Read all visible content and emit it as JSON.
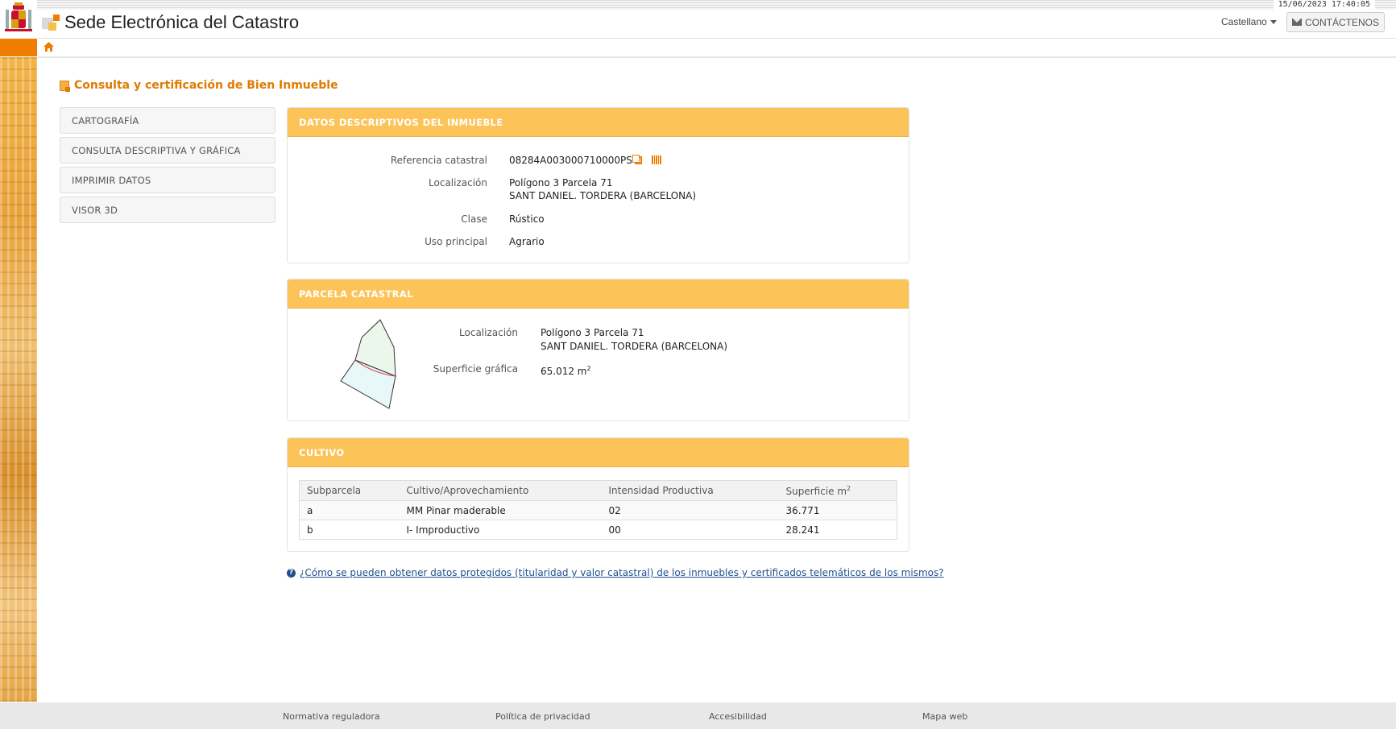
{
  "header": {
    "datetime": "15/06/2023  17:40:05",
    "site_title": "Sede Electrónica del Catastro",
    "language": "Castellano",
    "contact_label": "CONTÁCTENOS"
  },
  "page": {
    "title": "Consulta y certificación de Bien Inmueble"
  },
  "menu": {
    "items": [
      {
        "label": "CARTOGRAFÍA"
      },
      {
        "label": "CONSULTA DESCRIPTIVA Y GRÁFICA"
      },
      {
        "label": "IMPRIMIR DATOS"
      },
      {
        "label": "VISOR 3D"
      }
    ]
  },
  "descriptive": {
    "heading": "DATOS DESCRIPTIVOS DEL INMUEBLE",
    "ref_label": "Referencia catastral",
    "ref_value": "08284A003000710000PS",
    "loc_label": "Localización",
    "loc_line1": "Polígono 3 Parcela 71",
    "loc_line2": "SANT DANIEL. TORDERA (BARCELONA)",
    "class_label": "Clase",
    "class_value": "Rústico",
    "use_label": "Uso principal",
    "use_value": "Agrario"
  },
  "parcel": {
    "heading": "PARCELA CATASTRAL",
    "loc_label": "Localización",
    "loc_line1": "Polígono 3 Parcela 71",
    "loc_line2": "SANT DANIEL. TORDERA (BARCELONA)",
    "area_label": "Superficie gráfica",
    "area_value": "65.012 m",
    "area_unit_sup": "2"
  },
  "crops": {
    "heading": "CULTIVO",
    "columns": {
      "subparcel": "Subparcela",
      "crop": "Cultivo/Aprovechamiento",
      "intensity": "Intensidad Productiva",
      "area": "Superficie m",
      "area_sup": "2"
    },
    "rows": [
      {
        "subparcel": "a",
        "crop": "MM Pinar maderable",
        "intensity": "02",
        "area": "36.771"
      },
      {
        "subparcel": "b",
        "crop": "I- Improductivo",
        "intensity": "00",
        "area": "28.241"
      }
    ]
  },
  "help": {
    "link_text": "¿Cómo se pueden obtener datos protegidos (titularidad y valor catastral) de los inmuebles y certificados telemáticos de los mismos?"
  },
  "footer": {
    "links": [
      "Normativa reguladora",
      "Política de privacidad",
      "Accesibilidad",
      "Mapa web"
    ]
  },
  "colors": {
    "accent_orange": "#f07d00",
    "panel_header": "#fcc359",
    "link_blue": "#1f4f8e"
  }
}
